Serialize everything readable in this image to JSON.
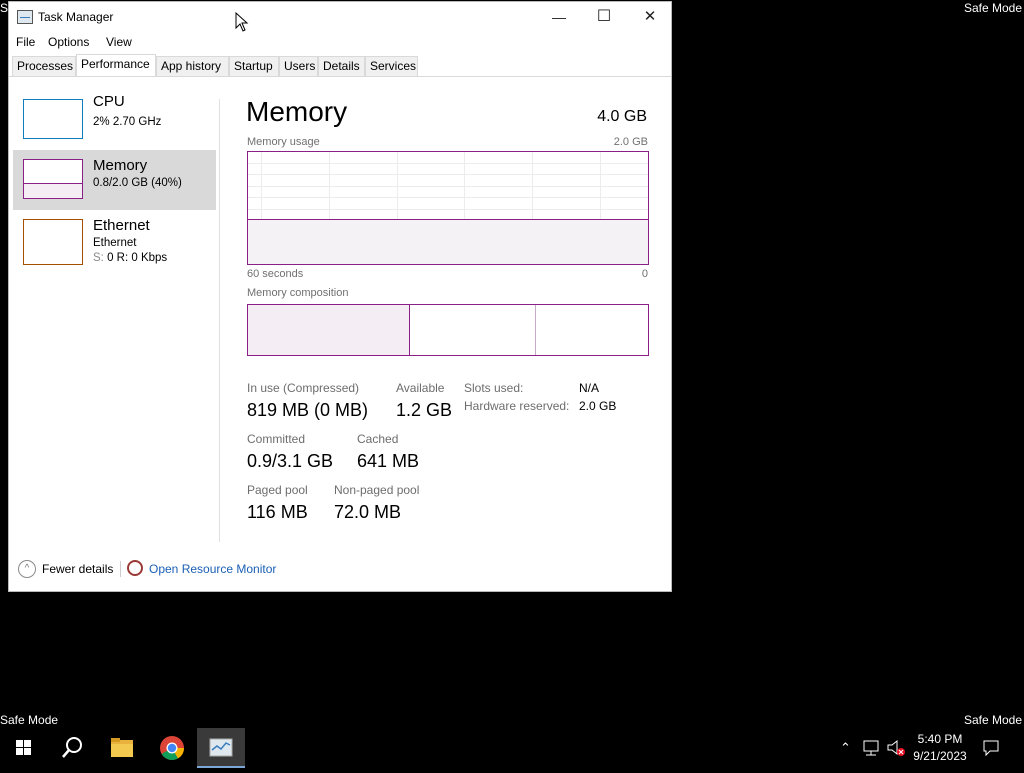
{
  "desktop": {
    "safe_mode_tl": "Sa",
    "safe_mode_tr": "Safe Mode",
    "safe_mode_bl": "Safe Mode",
    "safe_mode_br": "Safe Mode"
  },
  "window": {
    "title": "Task Manager",
    "controls": {
      "minimize": "—",
      "maximize": "☐",
      "close": "✕"
    }
  },
  "menu": [
    "File",
    "Options",
    "View"
  ],
  "tabs": [
    "Processes",
    "Performance",
    "App history",
    "Startup",
    "Users",
    "Details",
    "Services"
  ],
  "sidebar": {
    "cpu": {
      "title": "CPU",
      "sub": "2%  2.70 GHz"
    },
    "memory": {
      "title": "Memory",
      "sub": "0.8/2.0 GB (40%)"
    },
    "ethernet": {
      "title": "Ethernet",
      "sub1": "Ethernet",
      "sub2_s": "S:",
      "sub2_rest": "0  R: 0 Kbps"
    }
  },
  "memory": {
    "title": "Memory",
    "total": "4.0 GB",
    "usage_label": "Memory usage",
    "usage_max": "2.0 GB",
    "usage_fraction": 0.4,
    "time_left": "60 seconds",
    "time_right": "0",
    "composition_label": "Memory composition",
    "stats": {
      "in_use_label": "In use (Compressed)",
      "in_use_value": "819 MB (0 MB)",
      "available_label": "Available",
      "available_value": "1.2 GB",
      "committed_label": "Committed",
      "committed_value": "0.9/3.1 GB",
      "cached_label": "Cached",
      "cached_value": "641 MB",
      "paged_label": "Paged pool",
      "paged_value": "116 MB",
      "nonpaged_label": "Non-paged pool",
      "nonpaged_value": "72.0 MB",
      "slots_label": "Slots used:",
      "slots_value": "N/A",
      "hw_label": "Hardware reserved:",
      "hw_value": "2.0 GB"
    }
  },
  "footer": {
    "fewer": "Fewer details",
    "resmon": "Open Resource Monitor"
  },
  "taskbar": {
    "time": "5:40 PM",
    "date": "9/21/2023"
  },
  "colors": {
    "memory_accent": "#8b1f88",
    "cpu_accent": "#117dbb",
    "ethernet_accent": "#a74f01",
    "link": "#1a5fb4"
  }
}
